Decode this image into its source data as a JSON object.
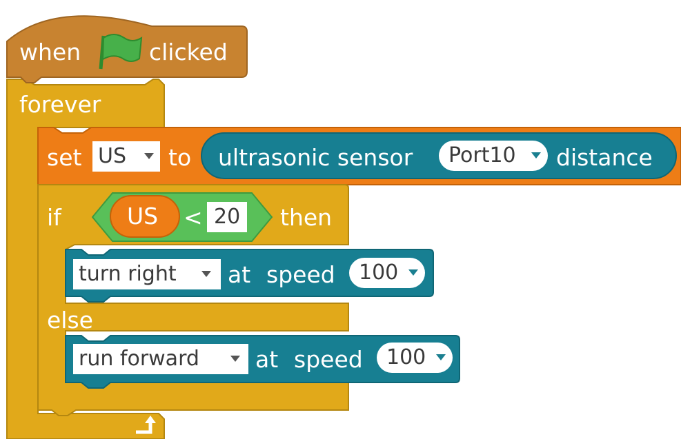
{
  "script": {
    "hat": {
      "when_label": "when",
      "flag_icon": "green-flag-icon",
      "clicked_label": "clicked"
    },
    "forever_label": "forever",
    "set_block": {
      "set_label": "set",
      "variable": "US",
      "to_label": "to",
      "reporter": {
        "label_before": "ultrasonic sensor",
        "port": "Port10",
        "label_after": "distance"
      }
    },
    "if_block": {
      "if_label": "if",
      "condition": {
        "variable": "US",
        "operator": "<",
        "value": "20"
      },
      "then_label": "then",
      "then_action": {
        "direction": "turn right",
        "at_label": "at",
        "speed_label": "speed",
        "speed": "100"
      },
      "else_label": "else",
      "else_action": {
        "direction": "run forward",
        "at_label": "at",
        "speed_label": "speed",
        "speed": "100"
      }
    },
    "loop_icon": "loop-arrow-icon"
  },
  "colors": {
    "hat": "#c88330",
    "control": "#e1a91a",
    "data": "#ee7d16",
    "sensor": "#177f92",
    "operator": "#59c059"
  }
}
